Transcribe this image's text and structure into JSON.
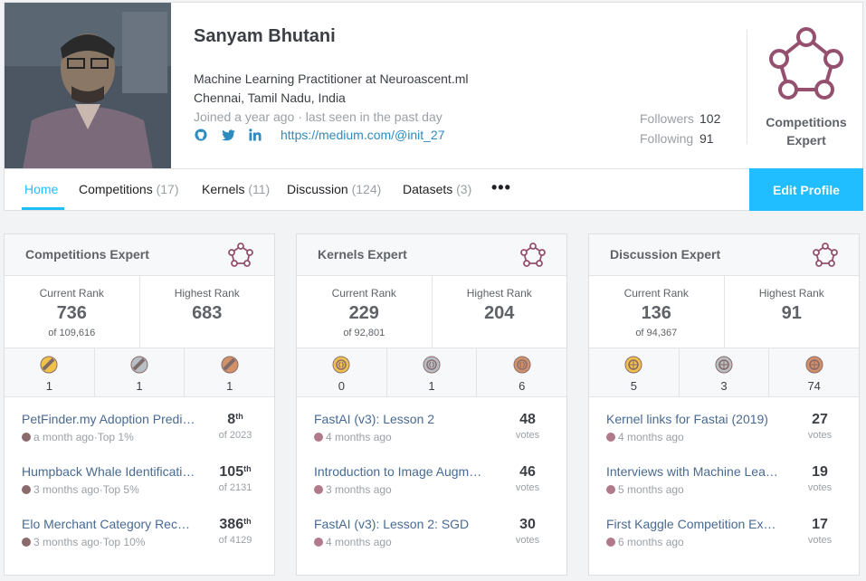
{
  "profile": {
    "name": "Sanyam Bhutani",
    "occupation": "Machine Learning Practitioner at Neuroascent.ml",
    "location": "Chennai, Tamil Nadu, India",
    "joined": "Joined a year ago · last seen in the past day",
    "website": "https://medium.com/@init_27",
    "followers_label": "Followers",
    "followers": "102",
    "following_label": "Following",
    "following": "91",
    "tier_line1": "Competitions",
    "tier_line2": "Expert"
  },
  "nav": {
    "home": "Home",
    "competitions": "Competitions",
    "competitions_count": "(17)",
    "kernels": "Kernels",
    "kernels_count": "(11)",
    "discussion": "Discussion",
    "discussion_count": "(124)",
    "datasets": "Datasets",
    "datasets_count": "(3)",
    "more": "•••",
    "edit": "Edit Profile"
  },
  "labels": {
    "current_rank": "Current Rank",
    "highest_rank": "Highest Rank"
  },
  "cards": [
    {
      "title": "Competitions Expert",
      "current_rank": "736",
      "of_total": "of 109,616",
      "highest_rank": "683",
      "medals": [
        "1",
        "1",
        "1"
      ],
      "entries": [
        {
          "title": "PetFinder.my Adoption Prediction",
          "meta": "a month ago·Top 1%",
          "big": "8",
          "sup": "th",
          "small": "of 2023"
        },
        {
          "title": "Humpback Whale Identification",
          "meta": "3 months ago·Top 5%",
          "big": "105",
          "sup": "th",
          "small": "of 2131"
        },
        {
          "title": "Elo Merchant Category Recommendation",
          "meta": "3 months ago·Top 10%",
          "big": "386",
          "sup": "th",
          "small": "of 4129"
        }
      ]
    },
    {
      "title": "Kernels Expert",
      "current_rank": "229",
      "of_total": "of 92,801",
      "highest_rank": "204",
      "medals": [
        "0",
        "1",
        "6"
      ],
      "entries": [
        {
          "title": "FastAI (v3): Lesson 2",
          "meta": "4 months ago",
          "big": "48",
          "sup": "",
          "small": "votes"
        },
        {
          "title": "Introduction to Image Augmentation",
          "meta": "3 months ago",
          "big": "46",
          "sup": "",
          "small": "votes"
        },
        {
          "title": "FastAI (v3): Lesson 2: SGD",
          "meta": "4 months ago",
          "big": "30",
          "sup": "",
          "small": "votes"
        }
      ]
    },
    {
      "title": "Discussion Expert",
      "current_rank": "136",
      "of_total": "of 94,367",
      "highest_rank": "91",
      "medals": [
        "5",
        "3",
        "74"
      ],
      "entries": [
        {
          "title": "Kernel links for Fastai (2019)",
          "meta": "4 months ago",
          "big": "27",
          "sup": "",
          "small": "votes"
        },
        {
          "title": "Interviews with Machine Learning Heroes",
          "meta": "5 months ago",
          "big": "19",
          "sup": "",
          "small": "votes"
        },
        {
          "title": "First Kaggle Competition Experience",
          "meta": "6 months ago",
          "big": "17",
          "sup": "",
          "small": "votes"
        }
      ]
    }
  ],
  "colors": {
    "accent": "#20beff",
    "gold": "#f1c24a",
    "silver": "#b8bfc4",
    "bronze": "#d29168",
    "tier_purple": "#96506f"
  }
}
